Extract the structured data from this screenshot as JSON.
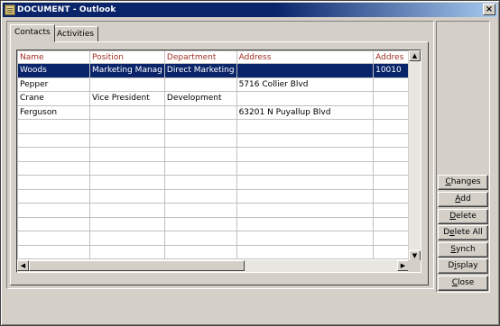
{
  "window": {
    "title": "DOCUMENT - Outlook",
    "close_label": "×"
  },
  "tabs": [
    {
      "label": "Contacts",
      "active": true
    },
    {
      "label": "Activities",
      "active": false
    }
  ],
  "table": {
    "columns": [
      "Name",
      "Position",
      "Department",
      "Address",
      "Addres"
    ],
    "rows": [
      [
        "Woods",
        "Marketing Manag",
        "Direct Marketing",
        "",
        "10010"
      ],
      [
        "Pepper",
        "",
        "",
        "5716 Collier Blvd",
        ""
      ],
      [
        "Crane",
        "Vice President",
        "Development",
        "",
        ""
      ],
      [
        "Ferguson",
        "",
        "",
        "63201 N Puyallup Blvd",
        ""
      ]
    ],
    "selected_row": 0,
    "empty_rows": 10
  },
  "buttons": [
    {
      "label": "Changes",
      "key": "C"
    },
    {
      "label": "Add",
      "key": "A"
    },
    {
      "label": "Delete",
      "key": "D"
    },
    {
      "label": "Delete All",
      "key": "e"
    },
    {
      "label": "Synch",
      "key": "S"
    },
    {
      "label": "Display",
      "key": "i"
    },
    {
      "label": "Close",
      "key": "C"
    }
  ],
  "colors": {
    "titlebar": "#0a246a",
    "selection": "#0a246a",
    "header_text": "#a03020"
  }
}
